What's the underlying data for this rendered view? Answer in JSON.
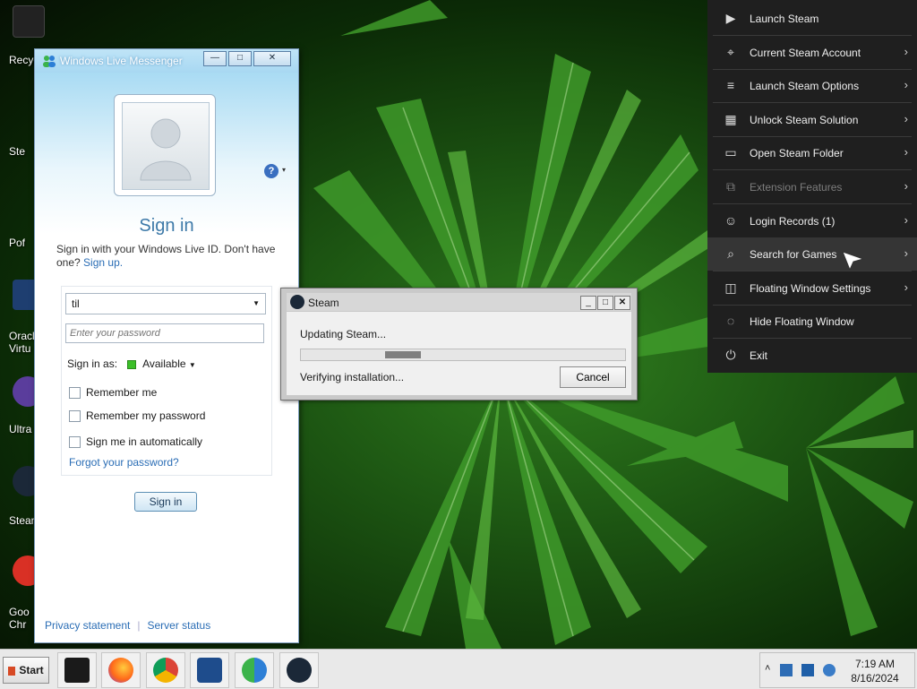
{
  "desktop": {
    "icons": [
      {
        "label": "Recyc"
      },
      {
        "label": "Ste"
      },
      {
        "label": "Pof"
      },
      {
        "label": "Oracl\nVirtu"
      },
      {
        "label": "Ultra"
      },
      {
        "label": "Steam"
      },
      {
        "label": "Goo\nChr"
      }
    ]
  },
  "messenger": {
    "window_title": "Windows Live Messenger",
    "title_buttons": {
      "minimize": "—",
      "maximize": "□",
      "close": "✕"
    },
    "heading": "Sign in",
    "description": "Sign in with your Windows Live ID. Don't have one?",
    "signup_link": "Sign up.",
    "account_value": "til",
    "password_placeholder": "Enter your password",
    "sign_in_as_label": "Sign in as:",
    "status_value": "Available",
    "remember_me": "Remember me",
    "remember_password": "Remember my password",
    "sign_in_automatically": "Sign me in automatically",
    "forgot_password": "Forgot your password?",
    "sign_in_button": "Sign in",
    "footer": {
      "privacy": "Privacy statement",
      "server_status": "Server status"
    },
    "help_icon": "?"
  },
  "steam_dialog": {
    "title": "Steam",
    "status": "Updating Steam...",
    "progress": 0.18,
    "detail": "Verifying installation...",
    "cancel_button": "Cancel"
  },
  "steam_menu": {
    "items": [
      {
        "label": "Launch Steam",
        "icon": "play-icon",
        "arrow": false,
        "disabled": false
      },
      {
        "label": "Current Steam Account",
        "icon": "location-pin-icon",
        "arrow": true,
        "disabled": false
      },
      {
        "label": "Launch Steam Options",
        "icon": "list-icon",
        "arrow": true,
        "disabled": false
      },
      {
        "label": "Unlock Steam Solution",
        "icon": "grid-icon",
        "arrow": true,
        "disabled": false
      },
      {
        "label": "Open Steam Folder",
        "icon": "folder-icon",
        "arrow": true,
        "disabled": false
      },
      {
        "label": "Extension Features",
        "icon": "extension-icon",
        "arrow": true,
        "disabled": true
      },
      {
        "label": "Login Records (1)",
        "icon": "user-icon",
        "arrow": true,
        "disabled": false
      },
      {
        "label": "Search for Games",
        "icon": "search-icon",
        "arrow": true,
        "disabled": false,
        "hover": true
      },
      {
        "label": "Floating Window Settings",
        "icon": "window-icon",
        "arrow": true,
        "disabled": false
      },
      {
        "label": "Hide Floating Window",
        "icon": "eye-off-icon",
        "arrow": false,
        "disabled": false
      },
      {
        "label": "Exit",
        "icon": "power-icon",
        "arrow": false,
        "disabled": false
      }
    ]
  },
  "taskbar": {
    "start_label": "Start",
    "apps": [
      "terminal-app",
      "firefox",
      "chrome",
      "virtualbox",
      "messenger",
      "steam"
    ],
    "clock_time": "7:19 AM",
    "clock_date": "8/16/2024",
    "tray_caret": "˄"
  }
}
